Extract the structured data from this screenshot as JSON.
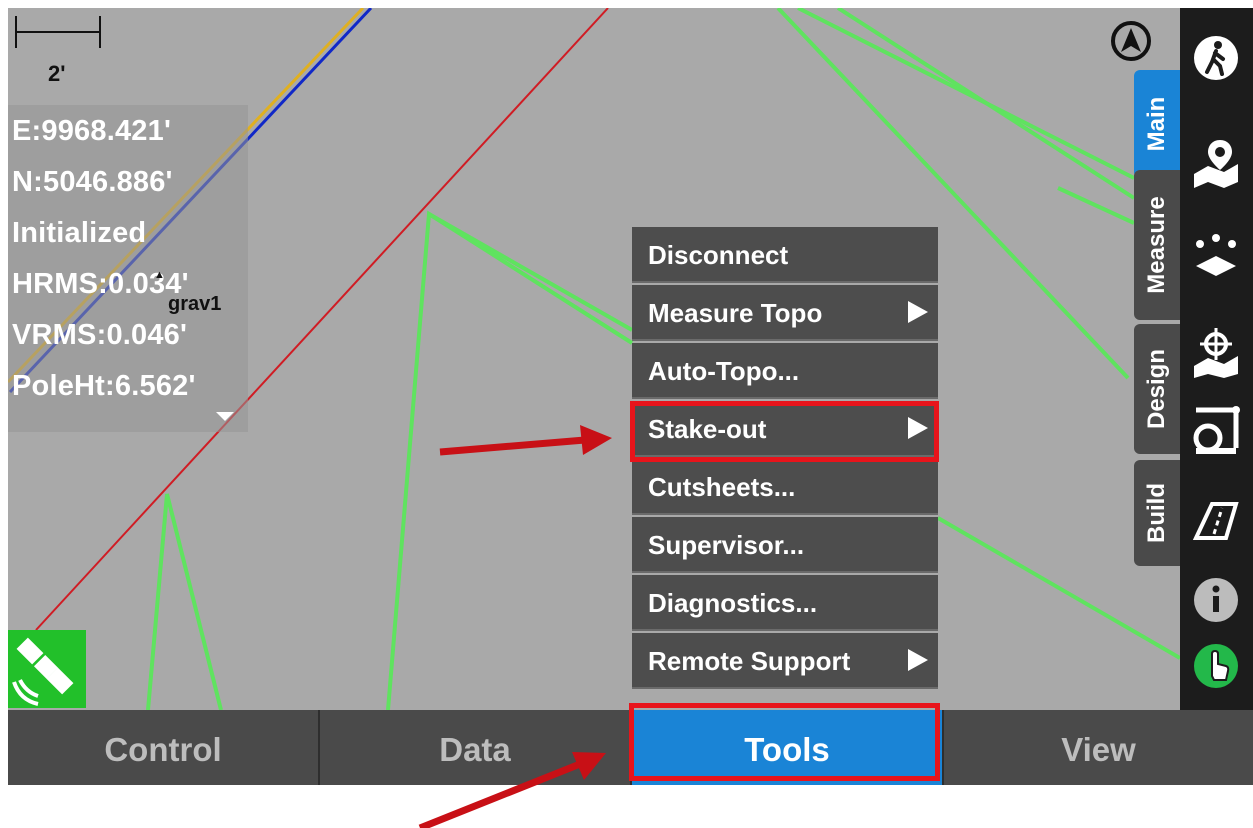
{
  "map": {
    "scale_label": "2'",
    "info_lines": [
      "E:9968.421'",
      "N:5046.886'",
      "Initialized",
      "HRMS:0.034'",
      "VRMS:0.046'",
      "PoleHt:6.562'"
    ],
    "point_label": "grav1",
    "point_marker": "▲",
    "compass_icon": "north-arrow-icon",
    "gnss_icon": "satellite-icon"
  },
  "side_tabs": [
    {
      "label": "Main",
      "active": true
    },
    {
      "label": "Measure",
      "active": false
    },
    {
      "label": "Design",
      "active": false
    },
    {
      "label": "Build",
      "active": false
    }
  ],
  "right_toolbar": {
    "icons": [
      "walking-person-icon",
      "map-pin-icon",
      "point-layout-icon",
      "target-map-icon",
      "tape-measure-icon",
      "road-icon",
      "info-icon",
      "hand-pointer-icon"
    ]
  },
  "tools_menu": {
    "items": [
      {
        "label": "Disconnect",
        "submenu": false
      },
      {
        "label": "Measure Topo",
        "submenu": true
      },
      {
        "label": "Auto-Topo...",
        "submenu": false
      },
      {
        "label": "Stake-out",
        "submenu": true
      },
      {
        "label": "Cutsheets...",
        "submenu": false
      },
      {
        "label": "Supervisor...",
        "submenu": false
      },
      {
        "label": "Diagnostics...",
        "submenu": false
      },
      {
        "label": "Remote Support",
        "submenu": true
      }
    ]
  },
  "bottom_bar": {
    "buttons": [
      {
        "label": "Control",
        "active": false
      },
      {
        "label": "Data",
        "active": false
      },
      {
        "label": "Tools",
        "active": true
      },
      {
        "label": "View",
        "active": false
      }
    ]
  },
  "colors": {
    "map_background": "#a9a9a9",
    "accent_blue": "#1a84d6",
    "highlight_red": "#e8141b",
    "line_green": "#5fe35f",
    "line_red": "#d01c24"
  }
}
